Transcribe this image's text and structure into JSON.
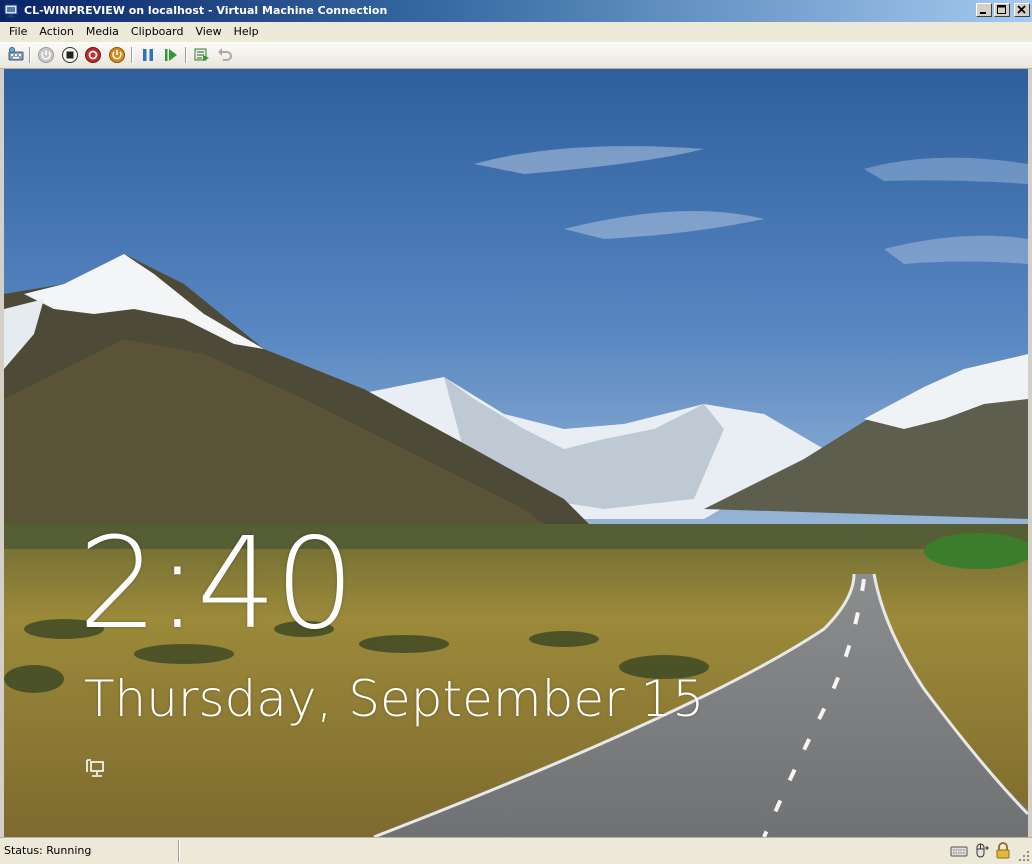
{
  "window": {
    "title": "CL-WINPREVIEW on localhost - Virtual Machine Connection",
    "controls": [
      "minimize",
      "maximize",
      "close"
    ]
  },
  "menu": {
    "items": [
      {
        "label": "File"
      },
      {
        "label": "Action"
      },
      {
        "label": "Media"
      },
      {
        "label": "Clipboard"
      },
      {
        "label": "View"
      },
      {
        "label": "Help"
      }
    ]
  },
  "toolbar": {
    "buttons": [
      {
        "name": "ctrl-alt-del-icon"
      },
      {
        "name": "start-icon"
      },
      {
        "name": "turn-off-icon"
      },
      {
        "name": "shut-down-icon"
      },
      {
        "name": "save-icon"
      },
      {
        "name": "pause-icon"
      },
      {
        "name": "resume-icon"
      },
      {
        "name": "snapshot-icon"
      },
      {
        "name": "revert-icon"
      }
    ]
  },
  "lock_screen": {
    "time": "2:40",
    "date": "Thursday, September 15",
    "network_icon": "network-icon"
  },
  "status": {
    "text": "Status: Running",
    "icons": [
      "keyboard-icon",
      "mouse-icon",
      "lock-icon"
    ]
  },
  "colors": {
    "title_bar": "#0a246a",
    "sky": "#4c7bb7",
    "shutdown_red": "#c62828",
    "save_orange": "#d78a1a",
    "pause_blue": "#2f74c0",
    "resume_green": "#2e9b35"
  }
}
